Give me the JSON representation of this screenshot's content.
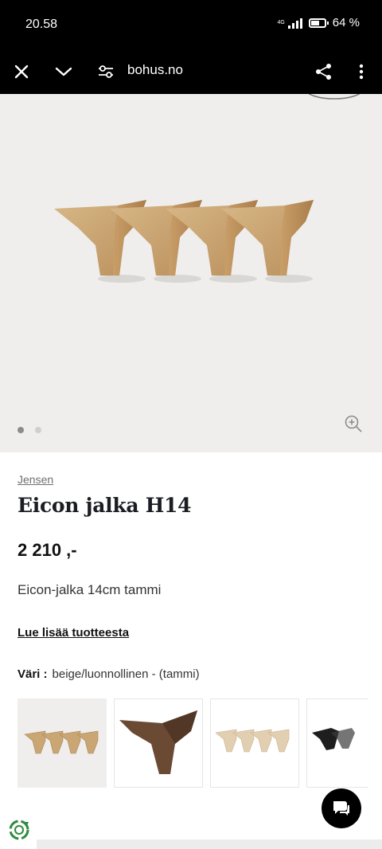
{
  "status": {
    "time": "20.58",
    "network": "4G",
    "battery": "64 %",
    "battery_level": 0.64
  },
  "browser": {
    "url": "bohus.no"
  },
  "icons": {
    "close": "close-icon",
    "chevron": "chevron-down-icon",
    "site-settings": "site-settings-icon",
    "share": "share-icon",
    "more": "more-icon",
    "zoom": "zoom-in-icon",
    "chat": "chat-icon",
    "recycle": "recycle-icon",
    "next": "chevron-right-icon"
  },
  "gallery": {
    "image_count": 2,
    "active_index": 0
  },
  "product": {
    "brand": "Jensen",
    "title": "Eicon jalka H14",
    "price": "2  210 ,-",
    "description": "Eicon-jalka 14cm tammi",
    "read_more": "Lue lisää tuotteesta",
    "color_label": "Väri :",
    "color_value": "beige/luonnollinen - (tammi)"
  },
  "swatches": [
    {
      "name": "oak-natural",
      "color": "#c9a674",
      "selected": true
    },
    {
      "name": "dark-brown",
      "color": "#6b4a34",
      "selected": false
    },
    {
      "name": "light-beige",
      "color": "#e2cfb2",
      "selected": false
    },
    {
      "name": "black",
      "color": "#1e1e1e",
      "selected": false
    }
  ],
  "colors": {
    "accent": "#000000",
    "hero_bg": "#efeeec",
    "wood": "#c9a674"
  }
}
